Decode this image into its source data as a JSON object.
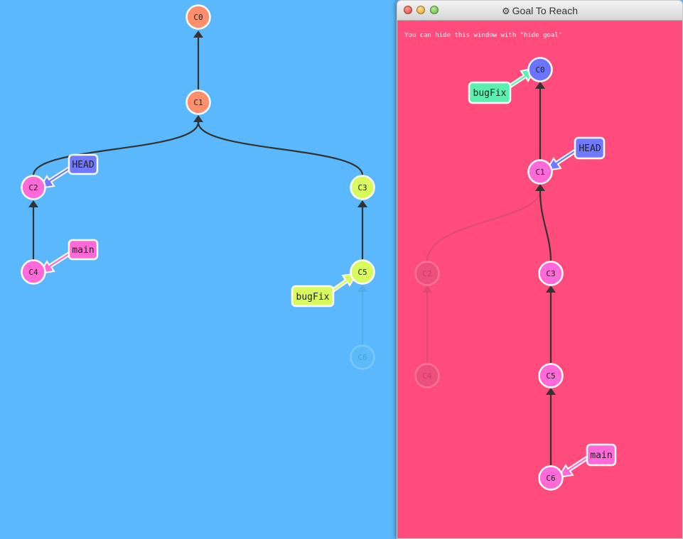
{
  "main_tree": {
    "commits": [
      {
        "id": "C0",
        "color": "#ff8f6b",
        "faded": false
      },
      {
        "id": "C1",
        "color": "#ff8f6b",
        "faded": false
      },
      {
        "id": "C2",
        "color": "#ff69d8",
        "faded": false
      },
      {
        "id": "C3",
        "color": "#d9fa5c",
        "faded": false
      },
      {
        "id": "C4",
        "color": "#ff69d8",
        "faded": false
      },
      {
        "id": "C5",
        "color": "#d9fa5c",
        "faded": false
      },
      {
        "id": "C6",
        "color": "#5cc0f0",
        "faded": true
      }
    ],
    "refs": {
      "head": "HEAD",
      "main": "main",
      "bugfix": "bugFix"
    }
  },
  "goal_window": {
    "title": "Goal To Reach",
    "hint": "You can hide this window with \"hide goal\"",
    "commits": [
      {
        "id": "C0",
        "color": "#6b74ff",
        "faded": false
      },
      {
        "id": "C1",
        "color": "#ff69d8",
        "faded": false
      },
      {
        "id": "C2",
        "color": "#d8547a",
        "faded": true
      },
      {
        "id": "C3",
        "color": "#ff69d8",
        "faded": false
      },
      {
        "id": "C4",
        "color": "#d8547a",
        "faded": true
      },
      {
        "id": "C5",
        "color": "#ff69d8",
        "faded": false
      },
      {
        "id": "C6",
        "color": "#ff69d8",
        "faded": false
      }
    ],
    "refs": {
      "bugfix": "bugFix",
      "head": "HEAD",
      "main": "main"
    }
  },
  "colors": {
    "background": "#5cb8fc",
    "goal_background": "#ff4c7c",
    "head_ref": "#7079ff",
    "main_ref": "#ff69d8",
    "bugfix_ref_main": "#d9fa5c",
    "bugfix_ref_goal": "#5cf0b0"
  }
}
